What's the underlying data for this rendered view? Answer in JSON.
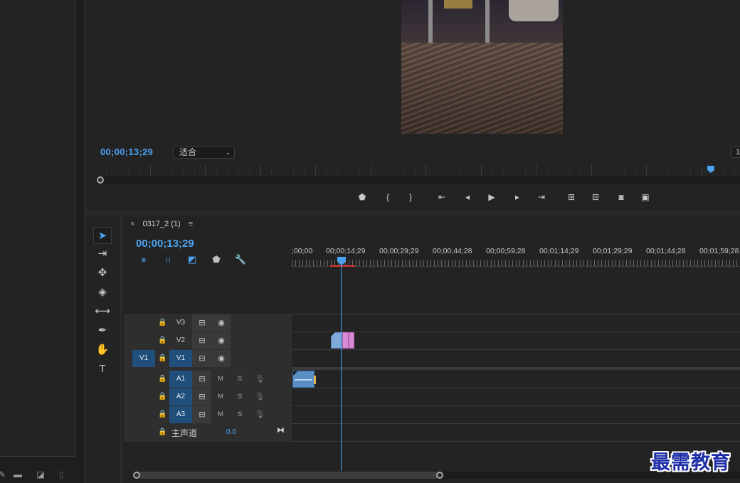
{
  "monitor": {
    "timecode": "00;00;13;29",
    "fit_value": "适合",
    "right_value": "1",
    "transport": [
      {
        "icon": "marker-icon",
        "glyph": "⬟"
      },
      {
        "icon": "mark-in-icon",
        "glyph": "{"
      },
      {
        "icon": "mark-out-icon",
        "glyph": "}"
      },
      {
        "icon": "go-to-in-icon",
        "glyph": "⇤"
      },
      {
        "icon": "step-back-icon",
        "glyph": "◂"
      },
      {
        "icon": "play-icon",
        "glyph": "▶"
      },
      {
        "icon": "step-forward-icon",
        "glyph": "▸"
      },
      {
        "icon": "go-to-out-icon",
        "glyph": "⇥"
      },
      {
        "icon": "lift-icon",
        "glyph": "⊞"
      },
      {
        "icon": "extract-icon",
        "glyph": "⊟"
      },
      {
        "icon": "export-frame-icon",
        "glyph": "◙"
      },
      {
        "icon": "comparison-view-icon",
        "glyph": "▣"
      }
    ]
  },
  "timeline": {
    "sequence_name": "0317_2 (1)",
    "close_glyph": "×",
    "menu_glyph": "≡",
    "timecode": "00;00;13;29",
    "ruler_labels": [
      ";00;00",
      "00;00;14;29",
      "00;00;29;29",
      "00;00;44;28",
      "00;00;59;28",
      "00;01;14;29",
      "00;01;29;29",
      "00;01;44;28",
      "00;01;59;28"
    ],
    "video_tracks": [
      {
        "name": "V3",
        "source": ""
      },
      {
        "name": "V2",
        "source": ""
      },
      {
        "name": "V1",
        "source": "V1"
      }
    ],
    "audio_tracks": [
      {
        "name": "A1",
        "m": "M",
        "s": "S"
      },
      {
        "name": "A2",
        "m": "M",
        "s": "S"
      },
      {
        "name": "A3",
        "m": "M",
        "s": "S"
      }
    ],
    "master": {
      "label": "主声道",
      "value": "0.0"
    }
  },
  "watermark": "最需教育",
  "colors": {
    "accent": "#4aa3f2",
    "track_active": "#1f4f7a",
    "clip_video": "#7fa9d8",
    "clip_pink": "#d98ad4",
    "work_area": "#e03434"
  }
}
